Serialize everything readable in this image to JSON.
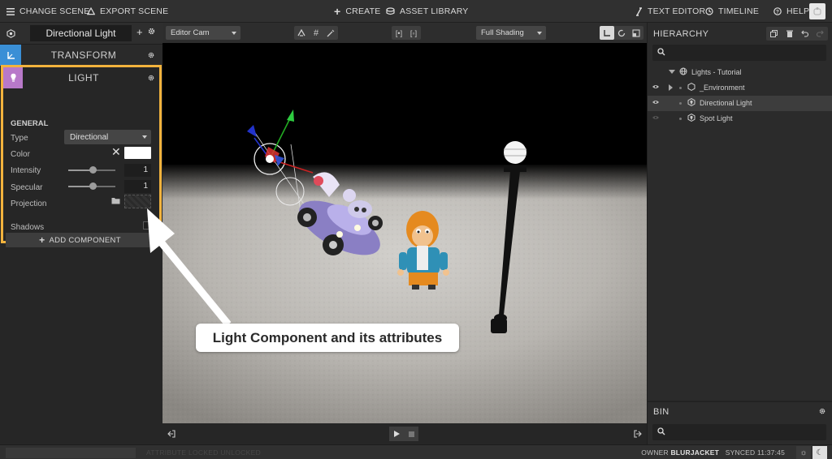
{
  "topbar": {
    "change_scene": "CHANGE SCENE",
    "export_scene": "EXPORT SCENE",
    "create": "CREATE",
    "asset_library": "ASSET LIBRARY",
    "text_editor": "TEXT EDITOR",
    "timeline": "TIMELINE",
    "help": "HELP"
  },
  "inspector": {
    "entity_name": "Directional Light",
    "transform_title": "TRANSFORM",
    "light_title": "LIGHT",
    "section_general": "GENERAL",
    "type_label": "Type",
    "type_value": "Directional",
    "color_label": "Color",
    "color_value": "#ffffff",
    "intensity_label": "Intensity",
    "intensity_value": "1",
    "specular_label": "Specular",
    "specular_value": "1",
    "projection_label": "Projection",
    "shadows_label": "Shadows",
    "shadows_checked": false,
    "add_component": "ADD COMPONENT"
  },
  "viewport": {
    "camera_select": "Editor Cam",
    "shading_select": "Full Shading"
  },
  "hierarchy": {
    "title": "HIERARCHY",
    "items": [
      {
        "label": "Lights - Tutorial",
        "icon": "globe-icon",
        "expanded": true
      },
      {
        "label": "_Environment",
        "icon": "hexagon-icon",
        "collapsed": true
      },
      {
        "label": "Directional Light",
        "icon": "light-bulb-icon",
        "selected": true
      },
      {
        "label": "Spot Light",
        "icon": "light-bulb-icon"
      }
    ]
  },
  "bin": {
    "title": "BIN"
  },
  "status": {
    "faded_text": "ATTRIBUTE LOCKED UNLOCKED",
    "owner_label": "OWNER",
    "owner_name": "BLURJACKET",
    "synced_label": "SYNCED",
    "synced_time": "11:37:45"
  },
  "annotation": {
    "text": "Light Component and its attributes"
  },
  "colors": {
    "accent_orange": "#f3b33d",
    "transform_blue": "#3a8fd6",
    "light_purple": "#b879c9"
  }
}
